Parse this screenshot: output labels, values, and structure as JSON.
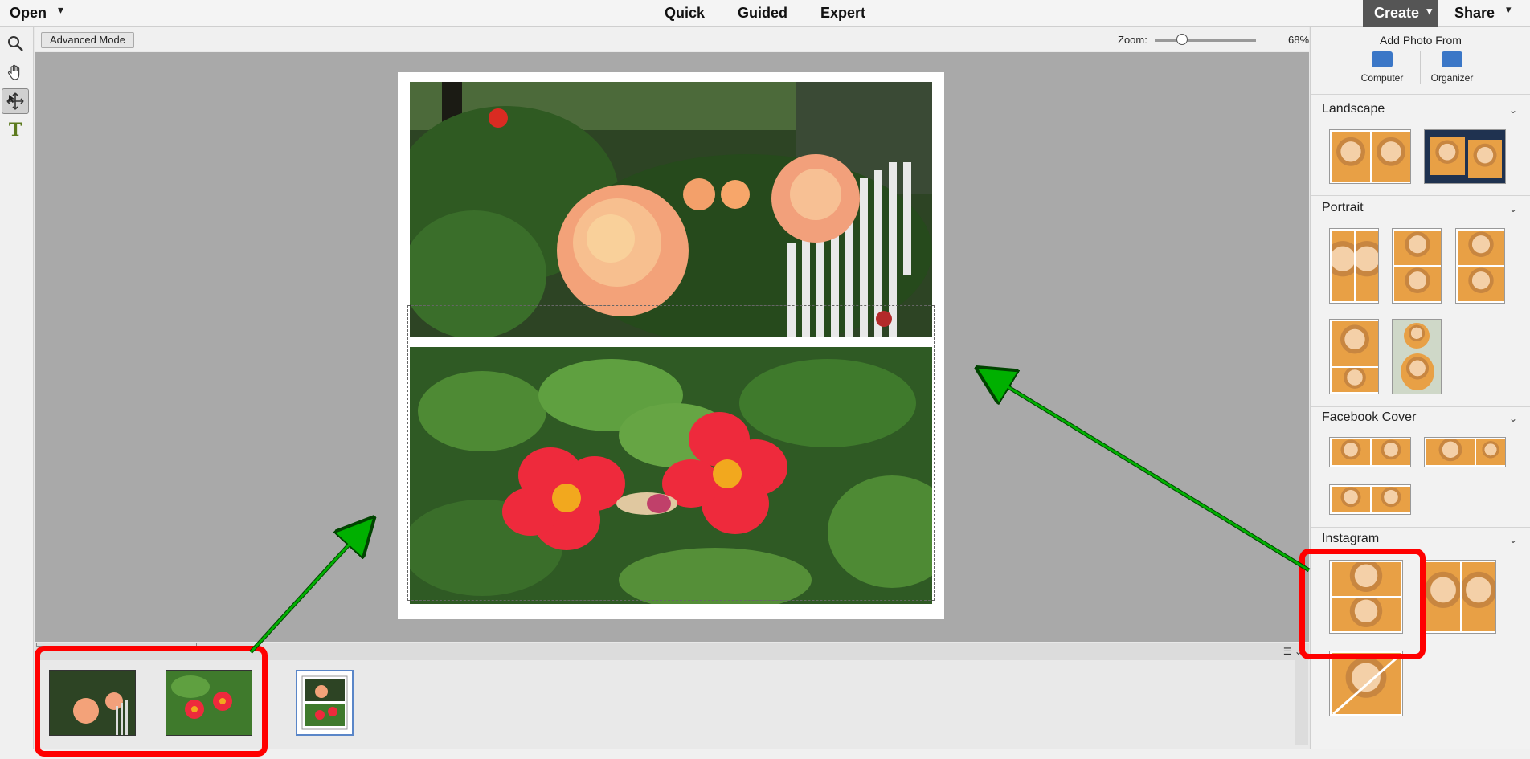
{
  "header": {
    "open_label": "Open",
    "modes": [
      "Quick",
      "Guided",
      "Expert"
    ],
    "create_label": "Create",
    "share_label": "Share"
  },
  "toolbox": {
    "tools": [
      "zoom-tool-icon",
      "hand-tool-icon",
      "move-tool-icon",
      "type-tool-icon"
    ],
    "type_glyph": "T"
  },
  "options_bar": {
    "mode_button": "Advanced Mode",
    "zoom_label": "Zoom:",
    "zoom_value": "68%",
    "zoom_level": 0.27
  },
  "panel": {
    "add_photo_from": "Add Photo From",
    "sources": [
      "Computer",
      "Organizer"
    ],
    "categories": [
      {
        "name": "Landscape"
      },
      {
        "name": "Portrait"
      },
      {
        "name": "Facebook Cover"
      },
      {
        "name": "Instagram"
      }
    ]
  },
  "colors": {
    "annotation_red": "#ff0000",
    "annotation_arrow": "#00b000",
    "create_bg": "#555555",
    "canvas_bg": "#a9a9a9"
  }
}
